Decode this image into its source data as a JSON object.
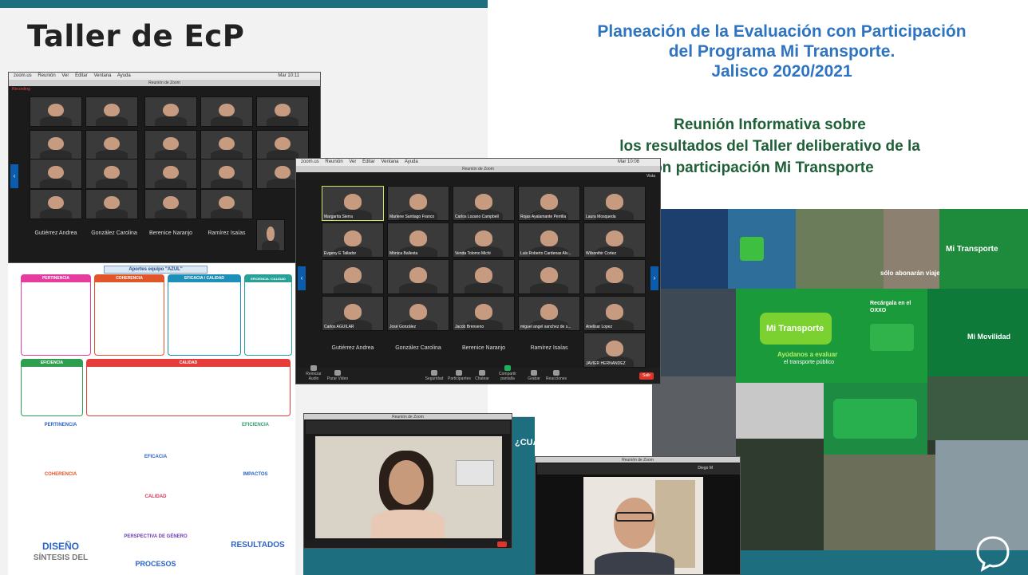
{
  "left_slide": {
    "title": "Taller de EcP",
    "poster": {
      "header": "Aportes equipo \"AZUL\"",
      "sections": [
        {
          "label": "PERTINENCIA",
          "color": "#e63ca0"
        },
        {
          "label": "COHERENCIA",
          "color": "#e0562a"
        },
        {
          "label": "EFICACIA / CALIDAD",
          "color": "#1e8fb8"
        },
        {
          "label": "EFICIENCIA / CALIDAD",
          "color": "#2aa198"
        },
        {
          "label": "CALIDAD",
          "color": "#e63c3c"
        },
        {
          "label": "EFICIENCIA",
          "color": "#2e9e4f"
        }
      ],
      "lower_headings": [
        {
          "text": "PERTINENCIA",
          "color": "#2b63c5"
        },
        {
          "text": "EFICIENCIA",
          "color": "#2b9e6e"
        },
        {
          "text": "EFICACIA",
          "color": "#2b63c5"
        },
        {
          "text": "COHERENCIA",
          "color": "#e0562a"
        },
        {
          "text": "IMPACTOS",
          "color": "#2b63c5"
        },
        {
          "text": "CALIDAD",
          "color": "#d23a5a"
        },
        {
          "text": "PERSPECTIVA DE GÉNERO",
          "color": "#6a3bb5"
        }
      ],
      "bottom_labels": {
        "diseno": "DISEÑO",
        "sintesis": "SÍNTESIS DEL",
        "procesos": "PROCESOS",
        "resultados": "RESULTADOS"
      }
    }
  },
  "zoom_back": {
    "menu": [
      "zoom.us",
      "Reunión",
      "Ver",
      "Editar",
      "Ventana",
      "Ayuda"
    ],
    "clock": "Mar 10:11",
    "window_title": "Reunión de Zoom",
    "recording": "Recording",
    "bottom_names": [
      "Gutiérrez Andrea",
      "González Carolina",
      "Berenice Naranjo",
      "Ramírez Isaías"
    ]
  },
  "zoom_front": {
    "menu": [
      "zoom.us",
      "Reunión",
      "Ver",
      "Editar",
      "Ventana",
      "Ayuda"
    ],
    "clock": "Mar 10:08",
    "window_title": "Reunión de Zoom",
    "view_label": "Vista",
    "tile_names": [
      [
        "Margarita Sierra",
        "Marlene Santiago Franco",
        "Carlos Lozano Campbell",
        "Rojas Ayalamante Perrilla",
        "Laura Mosqueda"
      ],
      [
        "Evgeny E Tallador",
        "Mónica Ballesta",
        "Venda Tolomo Michi",
        "Luis Roberto Cardenas Alv...",
        "Wilsonthir Cortez"
      ],
      [
        "",
        "",
        "",
        "",
        ""
      ],
      [
        "Carlos AGUILAR",
        "José González",
        "Jacob Brenseno",
        "miguel angel sanchez de s...",
        "Anelisar Lopez"
      ]
    ],
    "bottom_names": [
      "Gutiérrez Andrea",
      "González Carolina",
      "Berenice Naranjo",
      "Ramírez Isaías",
      "JAVIER HERNANDEZ"
    ],
    "toolbar": [
      "Reiniciar Audio",
      "Parar Video",
      "Seguridad",
      "Participantes",
      "Chatear",
      "Compartir pantalla",
      "Grabar",
      "Reacciones"
    ],
    "participants_count": "22",
    "end_label": "Salir"
  },
  "zoom_small_1": {
    "window_title": "Reunión de Zoom"
  },
  "zoom_small_2": {
    "window_title": "Reunión de Zoom",
    "user_label": "Diego M"
  },
  "right_slide": {
    "title_lines": [
      "Planeación de la Evaluación con Participación",
      "del Programa Mi Transporte.",
      "Jalisco 2020/2021"
    ],
    "subtitle_lines": [
      "Reunión Informativa sobre",
      "los resultados del Taller deliberativo de la",
      "uación con participación Mi Transporte"
    ],
    "collage": {
      "mi_transporte": "Mi Transporte",
      "solo_abonaran": "sólo abonarán viaje.",
      "ayudanos": "Ayúdanos a evaluar",
      "transporte_publico": "el transporte público",
      "recargalo": "Recárgala en el OXXO",
      "mi_movilidad": "Mi Movilidad",
      "mi_transporte_small": "Mi Transporte",
      "cuales_son": "¿CUÁLES SON LAS"
    },
    "colors": {
      "title_blue": "#2e74c0",
      "subtitle_green": "#1f5f38",
      "brand_green": "#1a9a3a",
      "band": "#1d6f80"
    }
  }
}
